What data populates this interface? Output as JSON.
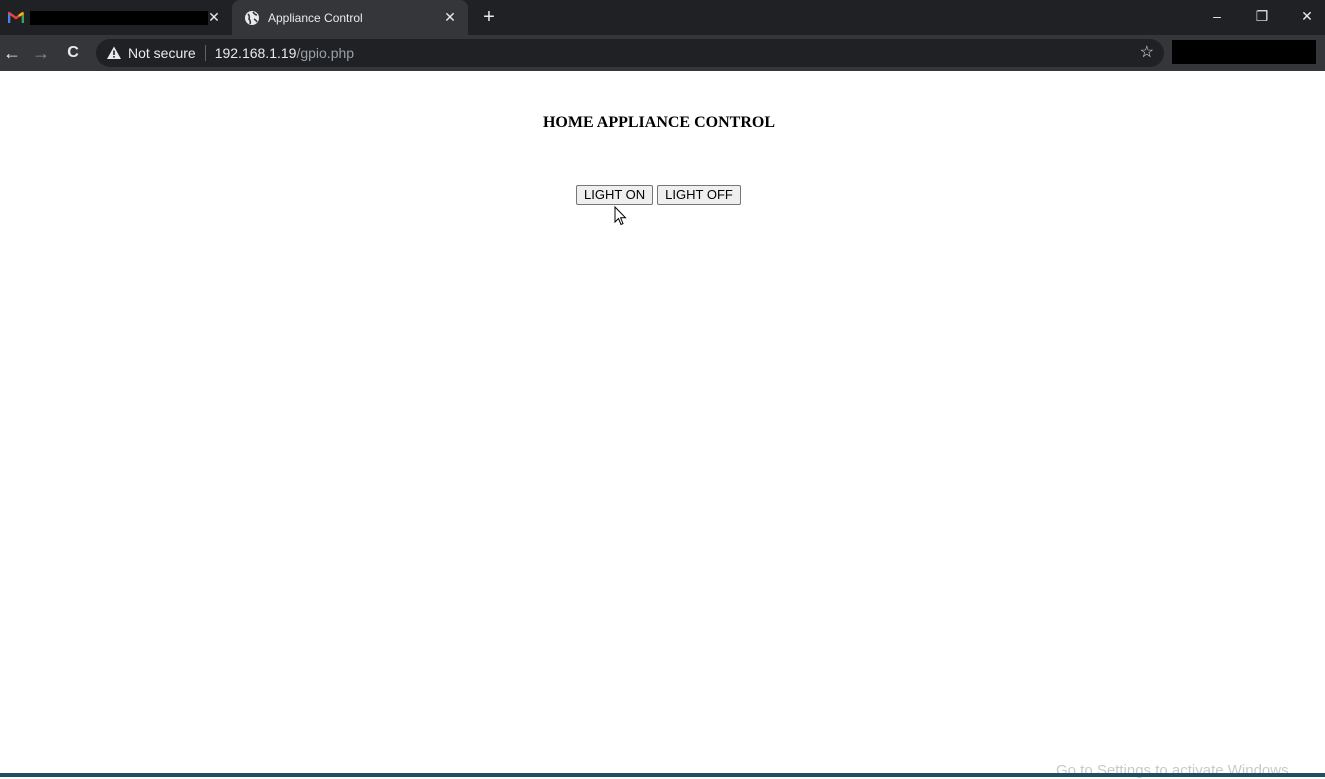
{
  "tabs": [
    {
      "title": "",
      "icon": "gmail-icon",
      "close": "✕"
    },
    {
      "title": "Appliance Control",
      "icon": "globe-icon",
      "close": "✕"
    }
  ],
  "new_tab": "+",
  "window_controls": {
    "minimize": "–",
    "restore": "❐",
    "close": "✕"
  },
  "toolbar": {
    "back": "←",
    "forward": "→",
    "reload": "C",
    "security_text": "Not secure",
    "url_host": "192.168.1.19",
    "url_path": "/gpio.php",
    "bookmark": "☆"
  },
  "page": {
    "title": "HOME APPLIANCE CONTROL",
    "buttons": {
      "light_on": "LIGHT ON",
      "light_off": "LIGHT OFF"
    }
  },
  "watermark": "Go to Settings to activate Windows.",
  "colors": {
    "chrome_dark": "#202124",
    "chrome_toolbar": "#35363a",
    "page_bg": "#ffffff",
    "button_bg": "#efefef"
  }
}
